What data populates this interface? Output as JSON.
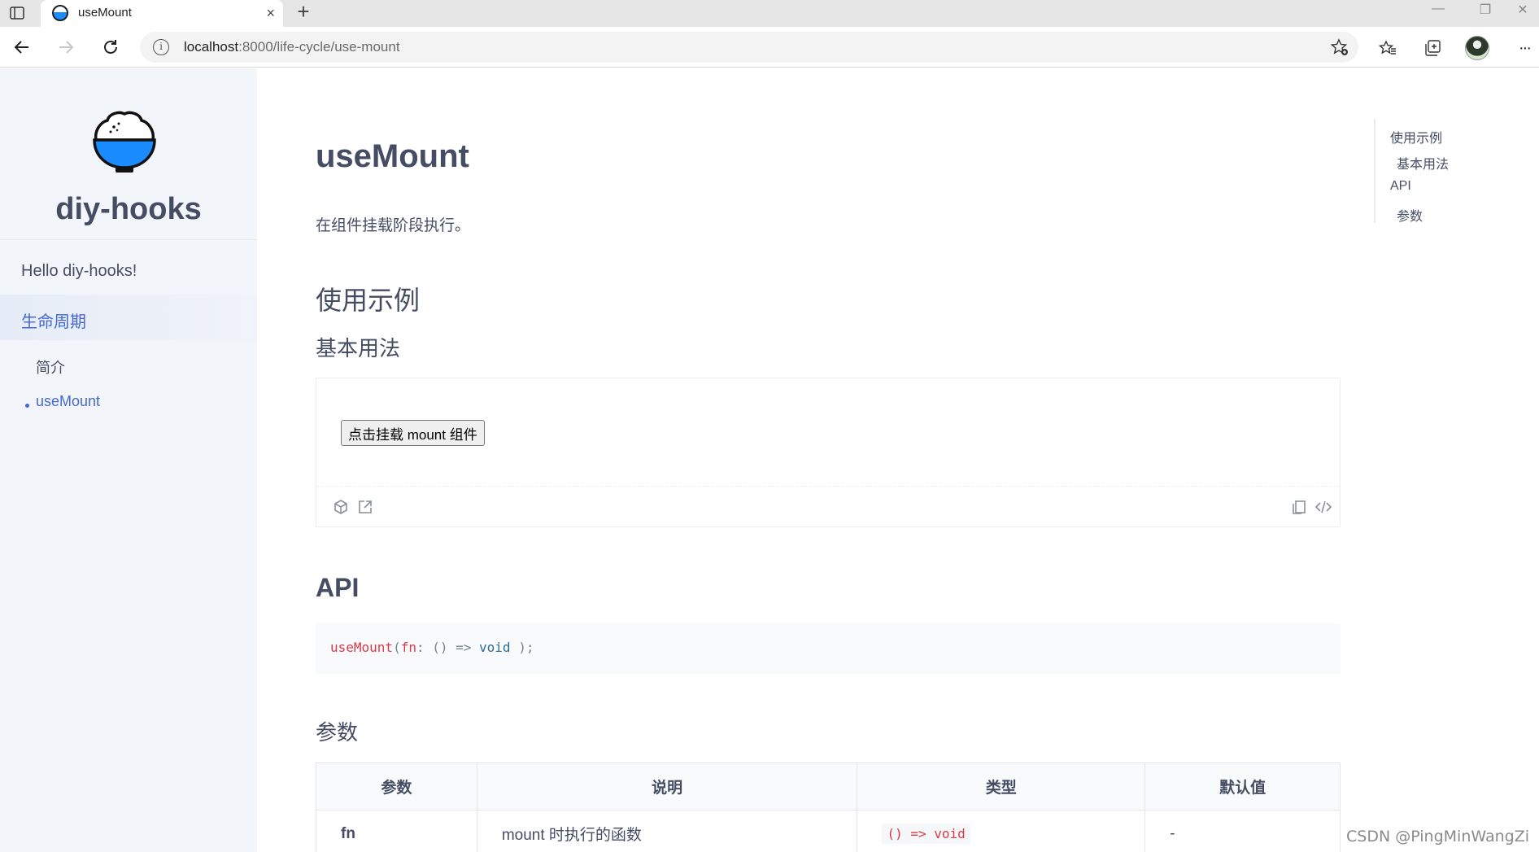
{
  "browser": {
    "tab_title": "useMount",
    "url_host": "localhost",
    "url_rest": ":8000/life-cycle/use-mount",
    "new_tab_symbol": "+",
    "close_symbol": "×",
    "window_controls": [
      "—",
      "❐",
      "✕"
    ],
    "more_symbol": "···"
  },
  "sidebar": {
    "site_title": "diy-hooks",
    "items": [
      {
        "label": "Hello diy-hooks!"
      },
      {
        "label": "生命周期"
      }
    ],
    "sub_items": [
      {
        "label": "简介"
      },
      {
        "label": "useMount"
      }
    ],
    "accent_color": "#4569d4"
  },
  "main": {
    "title": "useMount",
    "description": "在组件挂载阶段执行。",
    "section_usage": "使用示例",
    "sub_basic": "基本用法",
    "demo_button": "点击挂载 mount 组件",
    "section_api": "API",
    "code": {
      "fn": "useMount",
      "open": "(",
      "param": "fn",
      "colon": ": ",
      "parens": "()",
      "arrow": " => ",
      "ret": "void",
      "close": " );"
    },
    "section_params": "参数",
    "table": {
      "headers": [
        "参数",
        "说明",
        "类型",
        "默认值"
      ],
      "rows": [
        {
          "name": "fn",
          "desc": "mount 时执行的函数",
          "type": "() => void",
          "default": "-"
        }
      ]
    }
  },
  "toc": {
    "items": [
      "使用示例",
      "基本用法",
      "API",
      "参数"
    ]
  },
  "watermark": "CSDN @PingMinWangZi"
}
